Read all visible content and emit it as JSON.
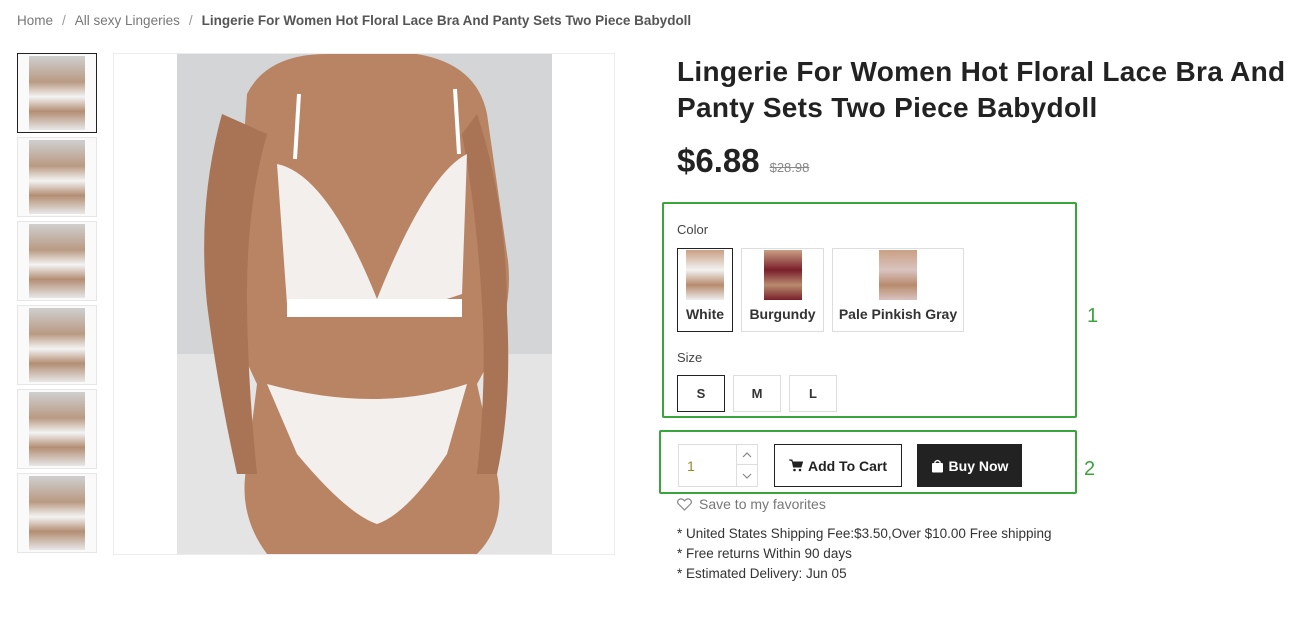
{
  "breadcrumb": {
    "home": "Home",
    "category": "All sexy Lingeries",
    "current": "Lingerie For Women Hot Floral Lace Bra And Panty Sets Two Piece Babydoll",
    "separator": "/"
  },
  "gallery": {
    "thumbnail_count": 6,
    "active_index": 0
  },
  "product": {
    "title": "Lingerie For Women Hot Floral Lace Bra And Panty Sets Two Piece Babydoll",
    "price": "$6.88",
    "old_price": "$28.98"
  },
  "options": {
    "color_label": "Color",
    "colors": [
      {
        "name": "White",
        "selected": true,
        "swatch": "#f2f2f2"
      },
      {
        "name": "Burgundy",
        "selected": false,
        "swatch": "#7a1f2b"
      },
      {
        "name": "Pale Pinkish Gray",
        "selected": false,
        "swatch": "#d9c3c0"
      }
    ],
    "size_label": "Size",
    "sizes": [
      {
        "name": "S",
        "selected": true
      },
      {
        "name": "M",
        "selected": false
      },
      {
        "name": "L",
        "selected": false
      }
    ]
  },
  "annotations": {
    "box1_label": "1",
    "box2_label": "2",
    "box_color": "#3aa53a"
  },
  "cart": {
    "quantity": "1",
    "add_to_cart_label": "Add To Cart",
    "buy_now_label": "Buy Now",
    "favorites_label": "Save to my favorites"
  },
  "info": {
    "lines": [
      "* United States Shipping Fee:$3.50,Over $10.00 Free shipping",
      "* Free returns Within 90 days",
      "* Estimated Delivery: Jun 05"
    ]
  }
}
